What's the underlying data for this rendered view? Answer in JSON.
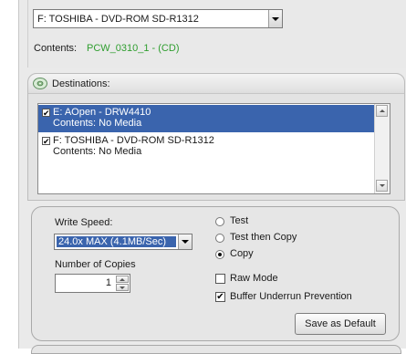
{
  "source": {
    "drive_label": "F: TOSHIBA  - DVD-ROM SD-R1312",
    "contents_label": "Contents:",
    "contents_value": "PCW_0310_1 - (CD)"
  },
  "destinations": {
    "title": "Destinations:",
    "items": [
      {
        "line1": "E: AOpen   - DRW4410",
        "line2": "Contents: No Media",
        "checked": true,
        "selected": true
      },
      {
        "line1": "F: TOSHIBA  - DVD-ROM SD-R1312",
        "line2": "Contents: No Media",
        "checked": true,
        "selected": false
      }
    ]
  },
  "settings": {
    "write_speed_label": "Write Speed:",
    "write_speed_value": "24.0x MAX (4.1MB/Sec)",
    "copies_label": "Number of Copies",
    "copies_value": "1",
    "modes": [
      {
        "label": "Test",
        "selected": false
      },
      {
        "label": "Test then Copy",
        "selected": false
      },
      {
        "label": "Copy",
        "selected": true
      }
    ],
    "raw_mode_label": "Raw Mode",
    "raw_mode_checked": false,
    "buffer_label": "Buffer Underrun Prevention",
    "buffer_checked": true,
    "save_default_label": "Save as Default"
  },
  "colors": {
    "selection": "#3a64ad",
    "contents_value": "#2f9e2f",
    "speed_text": "#1f3fa8"
  }
}
